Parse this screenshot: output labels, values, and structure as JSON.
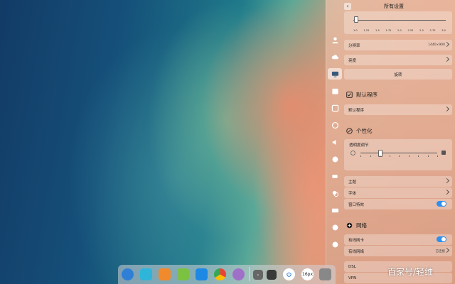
{
  "window": {
    "title": "所有设置"
  },
  "display": {
    "scale_ticks": [
      "1.0",
      "1.25",
      "1.5",
      "1.75",
      "2.0",
      "2.25",
      "2.5",
      "2.75",
      "3.0"
    ],
    "resolution_label": "分辨率",
    "resolution_value": "1440×900",
    "brightness_label": "亮度",
    "rotate_label": "旋转"
  },
  "default_apps": {
    "title": "默认程序",
    "row_label": "默认程序"
  },
  "personalization": {
    "title": "个性化",
    "opacity_label": "透明度调节",
    "opacity_level": 0.25,
    "theme_label": "主题",
    "font_label": "字体",
    "window_effect_label": "窗口特效"
  },
  "network": {
    "title": "网络",
    "wired_label": "有线网卡",
    "wired_network_label": "有线网络",
    "wired_network_value": "已连接",
    "dsl_label": "DSL",
    "vpn_label": "VPN"
  },
  "watermark": "百家号/轻维",
  "dock": {
    "ai_label": "16px"
  }
}
